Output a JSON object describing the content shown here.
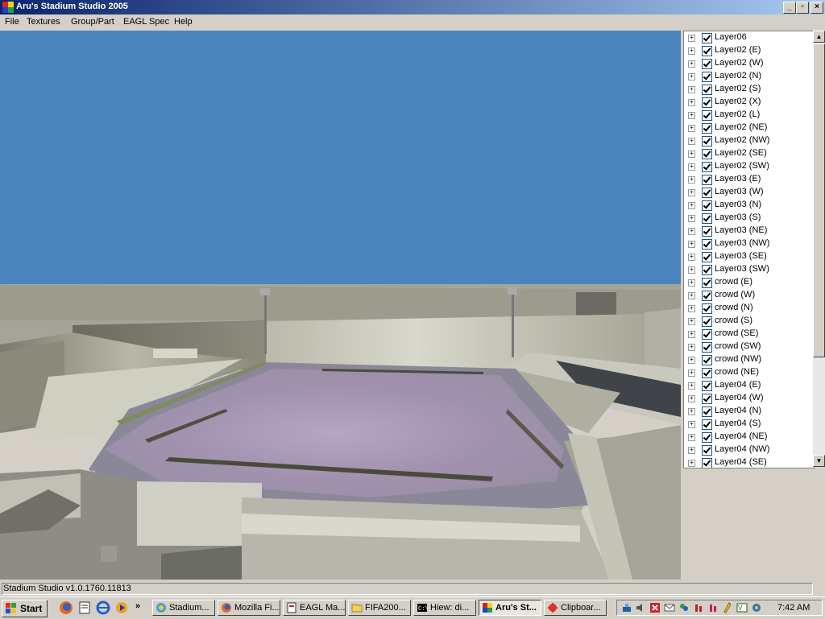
{
  "window": {
    "title": "Aru's Stadium Studio 2005"
  },
  "menu": [
    "File",
    "Textures",
    "Group/Part",
    "EAGL Spec",
    "Help"
  ],
  "layers": [
    "Layer06",
    "Layer02 (E)",
    "Layer02 (W)",
    "Layer02 (N)",
    "Layer02 (S)",
    "Layer02 (X)",
    "Layer02 (L)",
    "Layer02 (NE)",
    "Layer02 (NW)",
    "Layer02 (SE)",
    "Layer02 (SW)",
    "Layer03 (E)",
    "Layer03 (W)",
    "Layer03 (N)",
    "Layer03 (S)",
    "Layer03 (NE)",
    "Layer03 (NW)",
    "Layer03 (SE)",
    "Layer03 (SW)",
    "crowd (E)",
    "crowd (W)",
    "crowd (N)",
    "crowd (S)",
    "crowd (SE)",
    "crowd (SW)",
    "crowd (NW)",
    "crowd (NE)",
    "Layer04 (E)",
    "Layer04 (W)",
    "Layer04 (N)",
    "Layer04 (S)",
    "Layer04 (NE)",
    "Layer04 (NW)",
    "Layer04 (SE)"
  ],
  "status": {
    "text": "Stadium Studio v1.0.1760.11813"
  },
  "taskbar": {
    "start_label": "Start",
    "tasks": [
      "Stadium...",
      "Mozilla Fi...",
      "EAGL Ma...",
      "FIFA200...",
      "Hiew: di...",
      "Aru's St...",
      "Clipboar..."
    ],
    "overflow": "»",
    "clock": "7:42 AM"
  },
  "colors": {
    "sky": "#4a85bd",
    "titlebar_start": "#0a246a",
    "titlebar_end": "#a6caf0",
    "pitch": "#a89ab4"
  }
}
